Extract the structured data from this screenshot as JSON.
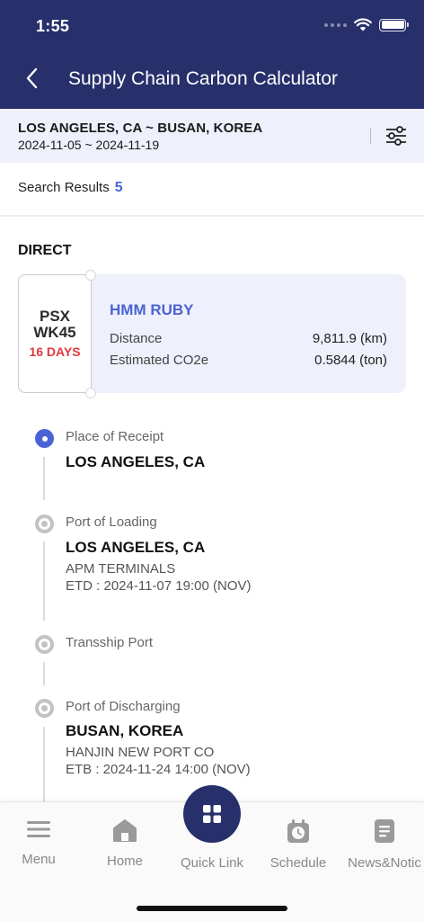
{
  "status_bar": {
    "time": "1:55"
  },
  "header": {
    "title": "Supply Chain Carbon Calculator",
    "back_icon": "chevron-left-icon"
  },
  "route": {
    "line1": "LOS ANGELES, CA ~ BUSAN, KOREA",
    "line2": "2024-11-05 ~ 2024-11-19",
    "filter_icon": "sliders-icon"
  },
  "results": {
    "label": "Search Results",
    "count": "5"
  },
  "section": {
    "label": "DIRECT"
  },
  "voyage": {
    "service": "PSX",
    "week": "WK45",
    "days": "16 DAYS",
    "vessel": "HMM RUBY",
    "distance_label": "Distance",
    "distance_value": "9,811.9 (km)",
    "co2_label": "Estimated CO2e",
    "co2_value": "0.5844 (ton)"
  },
  "timeline": [
    {
      "label": "Place of Receipt",
      "place": "LOS ANGELES, CA"
    },
    {
      "label": "Port of Loading",
      "place": "LOS ANGELES, CA",
      "terminal": "APM TERMINALS",
      "time": "ETD : 2024-11-07 19:00 (NOV)"
    },
    {
      "label": "Transship Port"
    },
    {
      "label": "Port of Discharging",
      "place": "BUSAN, KOREA",
      "terminal": "HANJIN NEW PORT CO",
      "time": "ETB : 2024-11-24 14:00 (NOV)"
    }
  ],
  "nav": {
    "menu": "Menu",
    "home": "Home",
    "quick": "Quick Link",
    "schedule": "Schedule",
    "news": "News&Notic"
  },
  "colors": {
    "header": "#27306b",
    "accent": "#4a63d4",
    "days": "#e0393e",
    "card_bg": "#eef0fb"
  }
}
